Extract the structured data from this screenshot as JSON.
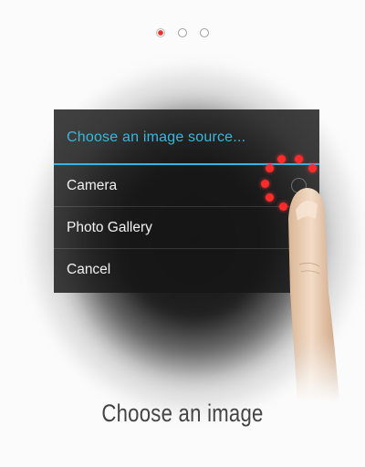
{
  "pager": {
    "pages": 3,
    "active_index": 0,
    "active_color": "#e8322f"
  },
  "dialog": {
    "title": "Choose an image source...",
    "title_color": "#39b7e0",
    "options": [
      {
        "label": "Camera"
      },
      {
        "label": "Photo Gallery"
      },
      {
        "label": "Cancel"
      }
    ]
  },
  "touch_indicator": {
    "icon": "tap-finger-icon",
    "ring_color": "#ff2a2a"
  },
  "caption": {
    "text": "Choose an image"
  }
}
